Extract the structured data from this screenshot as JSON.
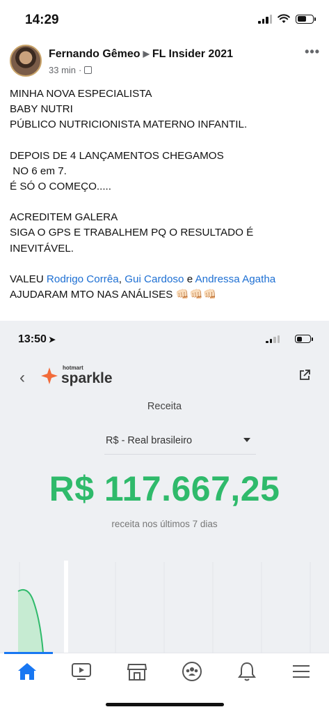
{
  "status_bar": {
    "time": "14:29"
  },
  "post": {
    "author": "Fernando Gêmeo",
    "arrow": "▶",
    "group": "FL Insider 2021",
    "time_ago": "33 min",
    "separator": "·",
    "more": "•••",
    "body": {
      "p1": "MINHA NOVA ESPECIALISTA\nBABY NUTRI\nPÚBLICO NUTRICIONISTA MATERNO INFANTIL.",
      "p2": "DEPOIS DE 4 LANÇAMENTOS CHEGAMOS\n NO 6 em 7.\nÉ SÓ O COMEÇO.....",
      "p3": "ACREDITEM GALERA\nSIGA O GPS E TRABALHEM PQ O RESULTADO É\nINEVITÁVEL.",
      "thanks_prefix": "VALEU ",
      "tag1": "Rodrigo Corrêa",
      "comma": ", ",
      "tag2": "Gui Cardoso",
      "and": " e ",
      "tag3": "Andressa Agatha",
      "last_line": "AJUDARAM MTO NAS ANÁLISES ",
      "emoji": "👊🏻👊🏻👊🏻"
    }
  },
  "screenshot": {
    "time": "13:50",
    "location_icon": "➤",
    "back": "‹",
    "logo_small": "hotmart",
    "logo_big": "sparkle",
    "revenue_label": "Receita",
    "currency": "R$ - Real brasileiro",
    "amount": "R$ 117.667,25",
    "period": "receita nos últimos 7 dias",
    "accent": "#2fba6b",
    "brand": "#f26b3a"
  },
  "nav": {
    "items": [
      "home-icon",
      "watch-icon",
      "marketplace-icon",
      "groups-icon",
      "notifications-icon",
      "menu-icon"
    ],
    "active_color": "#1877f2"
  }
}
